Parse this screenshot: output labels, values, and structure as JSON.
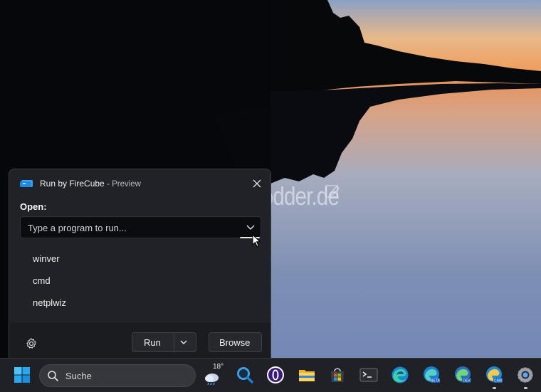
{
  "dialog": {
    "app_name": "Run by FireCube",
    "subtitle": "- Preview",
    "open_label": "Open:",
    "input_placeholder": "Type a program to run...",
    "history": [
      "winver",
      "cmd",
      "netplwiz"
    ],
    "run_label": "Run",
    "browse_label": "Browse"
  },
  "watermark": "Deskmodder.de",
  "taskbar": {
    "search_text": "Suche",
    "weather_temp": "18°",
    "pinned_icons": [
      "start-icon",
      "weather-icon",
      "magnifier-icon",
      "opera-icon",
      "file-explorer-icon",
      "store-icon",
      "terminal-icon",
      "edge-icon",
      "edge-beta-icon",
      "edge-dev-icon",
      "edge-canary-icon",
      "settings-icon"
    ]
  },
  "colors": {
    "accent": "#1e88e5",
    "dialog_bg": "#202227",
    "taskbar_bg": "#1f2126"
  }
}
